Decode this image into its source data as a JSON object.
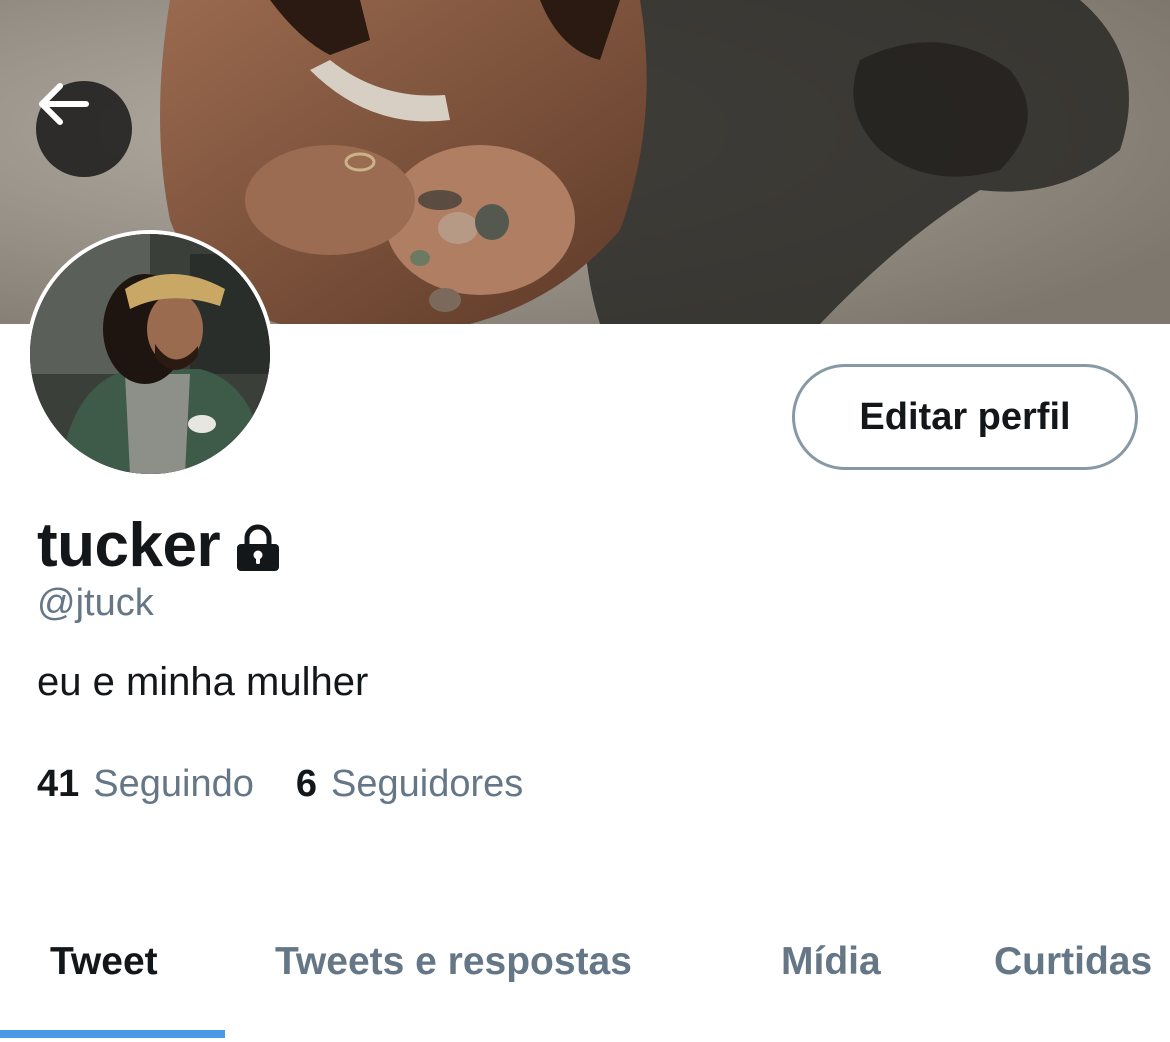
{
  "header": {
    "back_icon": "arrow-left-icon"
  },
  "profile": {
    "display_name": "tucker",
    "protected_icon": "lock-icon",
    "handle": "@jtuck",
    "bio": "eu e minha mulher",
    "edit_button_label": "Editar perfil",
    "stats": {
      "following_count": "41",
      "following_label": "Seguindo",
      "followers_count": "6",
      "followers_label": "Seguidores"
    }
  },
  "tabs": [
    {
      "label": "Tweet",
      "active": true
    },
    {
      "label": "Tweets e respostas",
      "active": false
    },
    {
      "label": "Mídia",
      "active": false
    },
    {
      "label": "Curtidas",
      "active": false
    }
  ],
  "colors": {
    "text_primary": "#14171a",
    "text_secondary": "#657786",
    "border": "#8899a6",
    "accent": "#4a99e9"
  }
}
